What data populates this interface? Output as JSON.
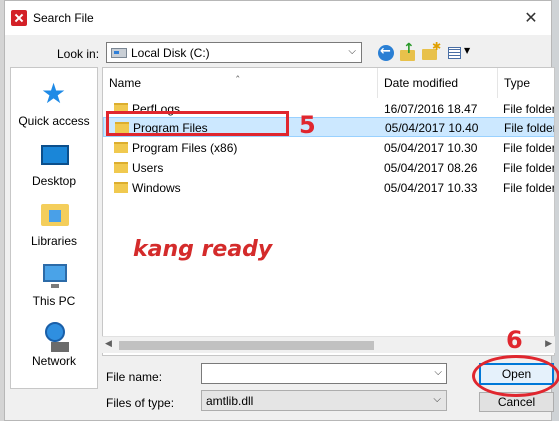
{
  "window": {
    "title": "Search File",
    "close_glyph": "✕"
  },
  "toolbar": {
    "look_in_label": "Look in:",
    "look_in_value": "Local Disk (C:)"
  },
  "places": [
    {
      "label": "Quick access",
      "icon": "quick-access-star-icon"
    },
    {
      "label": "Desktop",
      "icon": "desktop-icon"
    },
    {
      "label": "Libraries",
      "icon": "libraries-icon"
    },
    {
      "label": "This PC",
      "icon": "this-pc-icon"
    },
    {
      "label": "Network",
      "icon": "network-icon"
    }
  ],
  "file_list": {
    "columns": [
      "Name",
      "Date modified",
      "Type"
    ],
    "rows": [
      {
        "name": "PerfLogs",
        "date": "16/07/2016 18.47",
        "type": "File folder",
        "selected": false
      },
      {
        "name": "Program Files",
        "date": "05/04/2017 10.40",
        "type": "File folder",
        "selected": true
      },
      {
        "name": "Program Files (x86)",
        "date": "05/04/2017 10.30",
        "type": "File folder",
        "selected": false
      },
      {
        "name": "Users",
        "date": "05/04/2017 08.26",
        "type": "File folder",
        "selected": false
      },
      {
        "name": "Windows",
        "date": "05/04/2017 10.33",
        "type": "File folder",
        "selected": false
      }
    ]
  },
  "annotations": {
    "overlay_text": "kang ready",
    "step_5": "5",
    "step_6": "6",
    "color": "#e0262e"
  },
  "form": {
    "file_name_label": "File name:",
    "file_name_value": "",
    "files_of_type_label": "Files of type:",
    "files_of_type_value": "amtlib.dll"
  },
  "buttons": {
    "open": "Open",
    "cancel": "Cancel"
  }
}
